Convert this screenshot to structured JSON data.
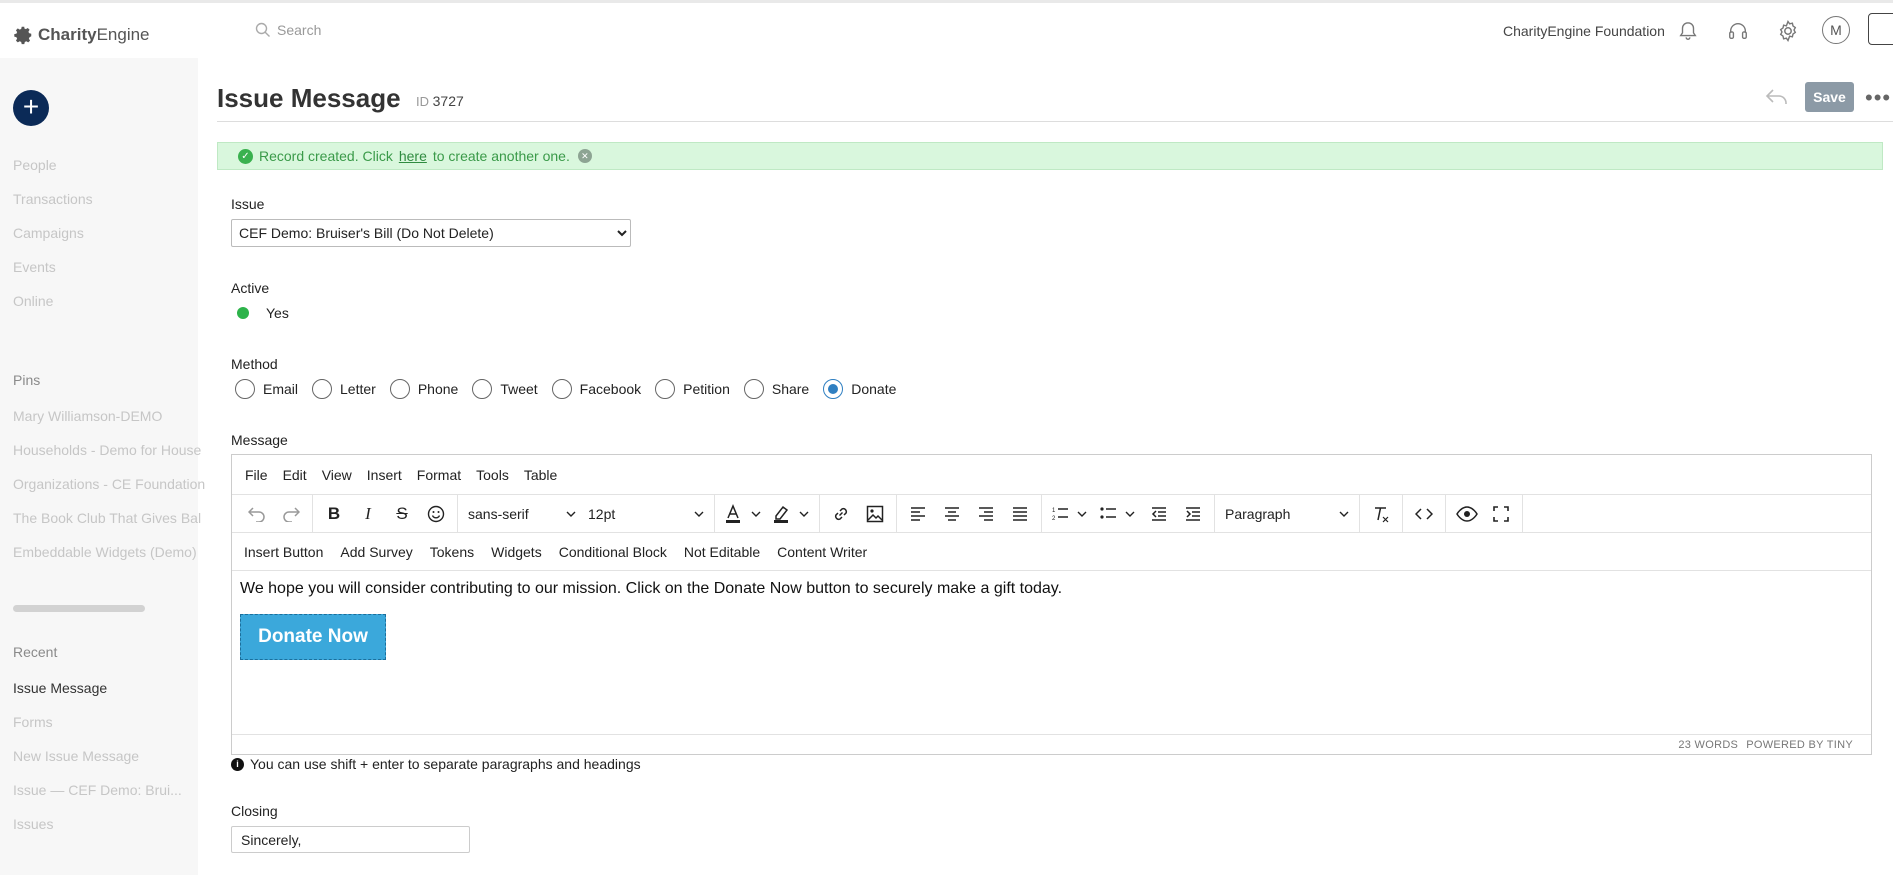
{
  "app": {
    "logo_bold": "Charity",
    "logo_rest": "Engine"
  },
  "topbar": {
    "search_placeholder": "Search",
    "org_name": "CharityEngine Foundation",
    "avatar_initial": "M"
  },
  "sidebar": {
    "add_label": "+",
    "nav": [
      "People",
      "Transactions",
      "Campaigns",
      "Events",
      "Online"
    ],
    "pins_heading": "Pins",
    "pins": [
      "Mary Williamson-DEMO",
      "Households - Demo for House",
      "Organizations - CE Foundation",
      "The Book Club That Gives Bal",
      "Embeddable Widgets (Demo)"
    ],
    "recent_heading": "Recent",
    "recent_active": "Issue Message",
    "recent": [
      "Forms",
      "New Issue Message",
      "Issue — CEF Demo: Brui...",
      "Issues"
    ]
  },
  "header": {
    "title": "Issue Message",
    "id_label": "ID",
    "id_value": "3727",
    "save_label": "Save",
    "more_label": "•••"
  },
  "banner": {
    "text_before": "Record created. Click",
    "link": "here",
    "text_after": "to create another one."
  },
  "form": {
    "issue_label": "Issue",
    "issue_value": "CEF Demo: Bruiser's Bill (Do Not Delete)",
    "active_label": "Active",
    "active_value": "Yes",
    "method_label": "Method",
    "methods": [
      "Email",
      "Letter",
      "Phone",
      "Tweet",
      "Facebook",
      "Petition",
      "Share",
      "Donate"
    ],
    "method_selected": "Donate",
    "message_label": "Message",
    "closing_label": "Closing",
    "closing_value": "Sincerely,"
  },
  "editor": {
    "menu": [
      "File",
      "Edit",
      "View",
      "Insert",
      "Format",
      "Tools",
      "Table"
    ],
    "font_family": "sans-serif",
    "font_size": "12pt",
    "block_format": "Paragraph",
    "custom_buttons": [
      "Insert Button",
      "Add Survey",
      "Tokens",
      "Widgets",
      "Conditional Block",
      "Not Editable",
      "Content Writer"
    ],
    "body_text": "We hope you will consider contributing to our mission. Click on the Donate Now button to securely make a gift today.",
    "donate_button": "Donate Now",
    "word_count": "23 WORDS",
    "powered_by": "POWERED BY TINY"
  },
  "hint": "You can use shift + enter to separate paragraphs and headings",
  "colors": {
    "primary": "#0b2a57",
    "success_bg": "#d9f7dd",
    "success_text": "#3a9a49",
    "accent_blue": "#2f7fc1",
    "donate_button": "#3ba8db",
    "save_button": "#8c9aa6"
  }
}
